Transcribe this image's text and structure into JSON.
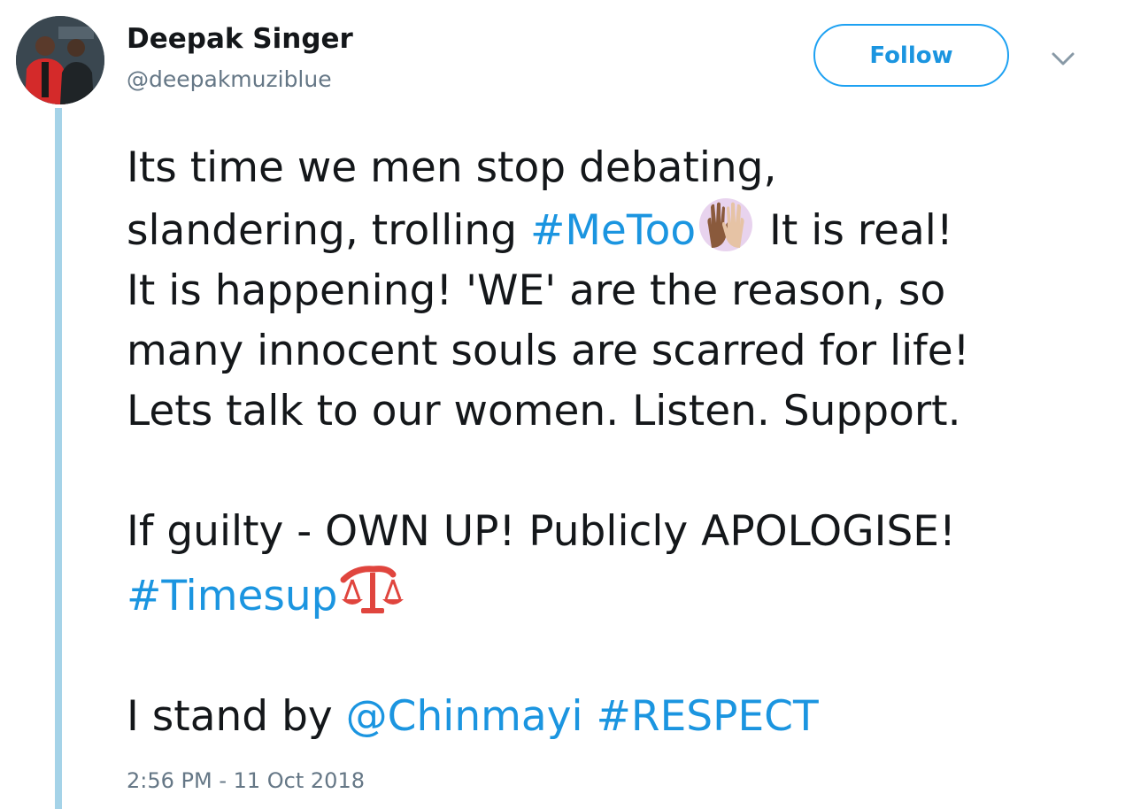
{
  "author": {
    "name": "Deepak Singer",
    "handle": "@deepakmuziblue",
    "avatar_icon": "profile-photo"
  },
  "actions": {
    "follow_label": "Follow",
    "menu_icon": "chevron-down-icon"
  },
  "tweet": {
    "line1": "Its time we men stop debating,",
    "line2_a": "slandering, trolling",
    "line2_hashtag": "#MeToo",
    "line2_b": " It is real!",
    "line3": "It is happening! 'WE' are the reason, so",
    "line4": "many innocent souls are scarred for life!",
    "line5": "Lets talk to our women. Listen. Support.",
    "line6": "If guilty - OWN UP! Publicly APOLOGISE!",
    "line7_hashtag": "#Timesup",
    "line8_a": "I stand by ",
    "line8_mention": "@Chinmayi",
    "line8_hashtag": "#RESPECT",
    "emoji_1": "raised-hands-emoji",
    "emoji_2": "scales-emoji"
  },
  "timestamp": "2:56 PM - 11 Oct 2018",
  "colors": {
    "link": "#1b95e0",
    "thread_line": "#a5d3e8",
    "muted": "#657786",
    "text": "#14171a"
  }
}
